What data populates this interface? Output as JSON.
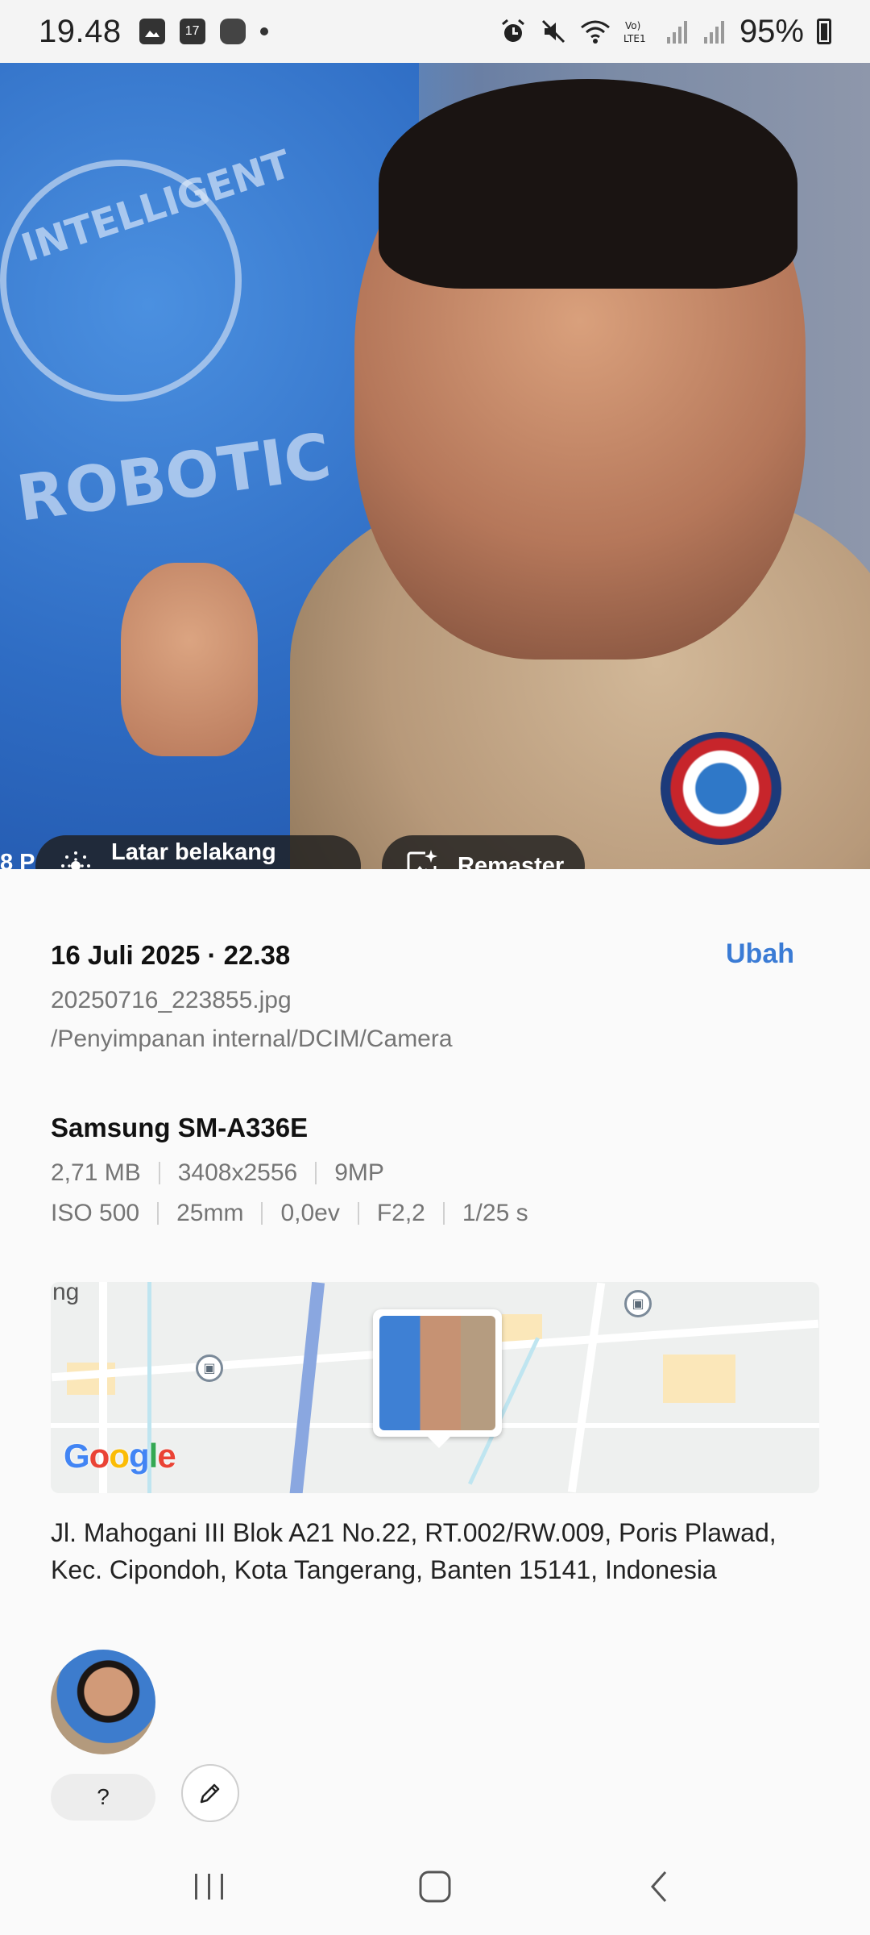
{
  "status_bar": {
    "time": "19.48",
    "battery": "95%",
    "icons": [
      "gallery-icon",
      "calendar-icon",
      "app-icon",
      "notification-dot",
      "alarm-icon",
      "mute-icon",
      "wifi-icon",
      "volte-icon",
      "signal-icon",
      "signal-icon",
      "battery-icon"
    ],
    "calendar_day": "17",
    "volte_label": "Vo) LTE1"
  },
  "photo": {
    "edge_text": "8 P",
    "actions": [
      {
        "label": "Latar belakang kabur",
        "icon": "blur-background-icon"
      },
      {
        "label": "Remaster",
        "icon": "remaster-icon"
      }
    ]
  },
  "details": {
    "date_time": "16 Juli 2025 · 22.38",
    "edit_label": "Ubah",
    "filename": "20250716_223855.jpg",
    "path": "/Penyimpanan internal/DCIM/Camera",
    "device": "Samsung SM-A336E",
    "specs_row1": [
      "2,71 MB",
      "3408x2556",
      "9MP"
    ],
    "specs_row2": [
      "ISO 500",
      "25mm",
      "0,0ev",
      "F2,2",
      "1/25 s"
    ]
  },
  "map": {
    "provider_logo": "Google",
    "partial_label": "ng"
  },
  "address": "Jl. Mahogani III Blok A21 No.22, RT.002/RW.009, Poris Plawad, Kec. Cipondoh, Kota Tangerang, Banten 15141, Indonesia",
  "people": {
    "unknown_label": "?"
  },
  "colors": {
    "accent": "#3a7bd5",
    "chip_bg": "#1e1e1e"
  }
}
